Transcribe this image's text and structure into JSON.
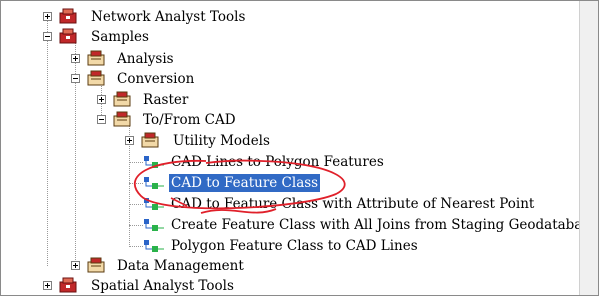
{
  "tree": {
    "network_analyst": "Network Analyst Tools",
    "samples": "Samples",
    "analysis": "Analysis",
    "conversion": "Conversion",
    "raster": "Raster",
    "to_from_cad": "To/From CAD",
    "utility_models": "Utility Models",
    "cad_lines_to_polygon": "CAD Lines to Polygon Features",
    "cad_to_feature_class": "CAD to Feature Class",
    "cad_to_fc_attr": "CAD to Feature Class with Attribute of Nearest Point",
    "create_fc_joins": "Create Feature Class with All Joins from Staging Geodatabase",
    "polygon_fc_to_cad": "Polygon Feature Class to CAD Lines",
    "data_management": "Data Management",
    "spatial_analyst": "Spatial Analyst Tools"
  },
  "colors": {
    "selection": "#316ac5",
    "annotation": "#e0202a",
    "toolbox_red": "#c0282a"
  }
}
